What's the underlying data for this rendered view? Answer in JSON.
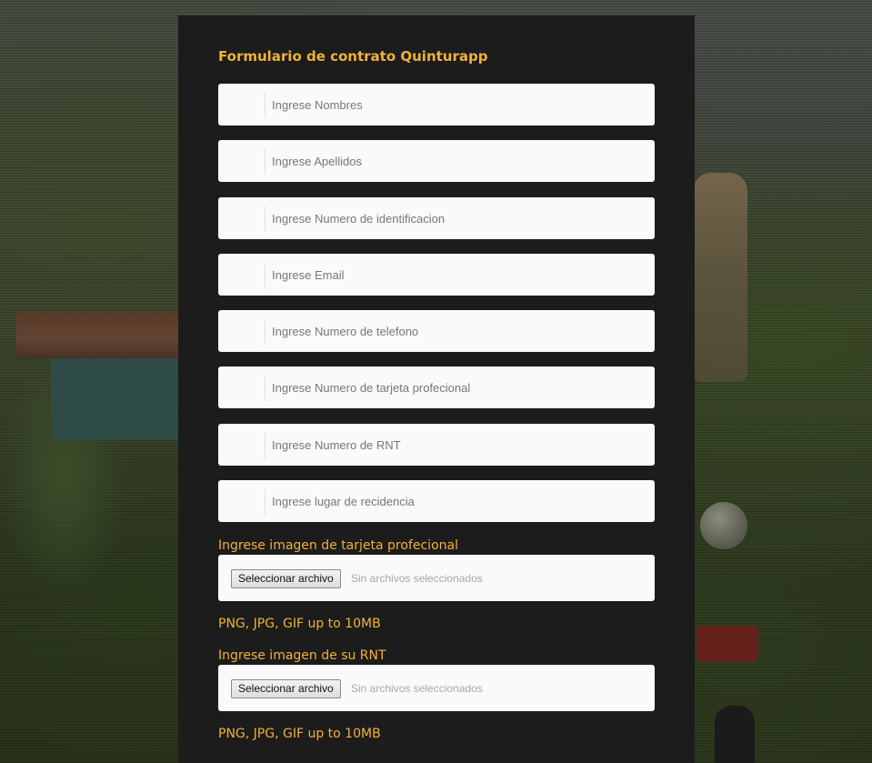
{
  "form": {
    "title": "Formulario de contrato Quinturapp",
    "fields": [
      {
        "placeholder": "Ingrese Nombres"
      },
      {
        "placeholder": "Ingrese Apellidos"
      },
      {
        "placeholder": "Ingrese Numero de identificacion"
      },
      {
        "placeholder": "Ingrese Email"
      },
      {
        "placeholder": "Ingrese Numero de telefono"
      },
      {
        "placeholder": "Ingrese Numero de tarjeta profecional"
      },
      {
        "placeholder": "Ingrese Numero de RNT"
      },
      {
        "placeholder": "Ingrese lugar de recidencia"
      }
    ],
    "uploads": [
      {
        "label": "Ingrese imagen de tarjeta profecional",
        "button_label": "Seleccionar archivo",
        "status": "Sin archivos seleccionados",
        "hint": "PNG, JPG, GIF up to 10MB"
      },
      {
        "label": "Ingrese imagen de su RNT",
        "button_label": "Seleccionar archivo",
        "status": "Sin archivos seleccionados",
        "hint": "PNG, JPG, GIF up to 10MB"
      }
    ]
  },
  "colors": {
    "accent": "#f0b13a",
    "panel": "#1c1c1c",
    "field_bg": "#fafafa"
  }
}
